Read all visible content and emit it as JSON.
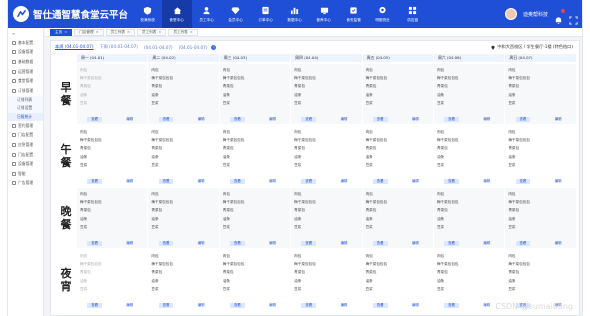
{
  "app": {
    "title": "智仕通智慧食堂云平台"
  },
  "nav": [
    {
      "label": "校满系统",
      "icon": "shield-icon"
    },
    {
      "label": "食堂中心",
      "icon": "home-icon",
      "active": true
    },
    {
      "label": "员工中心",
      "icon": "user-icon"
    },
    {
      "label": "会员中心",
      "icon": "diamond-icon"
    },
    {
      "label": "订单中心",
      "icon": "order-icon"
    },
    {
      "label": "数据中心",
      "icon": "chart-icon"
    },
    {
      "label": "营养中心",
      "icon": "tv-icon"
    },
    {
      "label": "食安监管",
      "icon": "box-icon"
    },
    {
      "label": "明厨亮灶",
      "icon": "camera-icon"
    },
    {
      "label": "供应链",
      "icon": "grid-icon"
    }
  ],
  "user": {
    "name": "迪奥帮科技"
  },
  "sidebar": {
    "header": "≡",
    "items": [
      {
        "label": "基本配置"
      },
      {
        "label": "设备管理"
      },
      {
        "label": "基础数据"
      },
      {
        "label": "运营管理"
      },
      {
        "label": "食堂管理"
      },
      {
        "label": "订餐管理"
      }
    ],
    "subitems": [
      {
        "label": "订餐列表"
      },
      {
        "label": "订餐设置"
      },
      {
        "label": "日报统计",
        "active": true
      }
    ],
    "items2": [
      {
        "label": "签约管理"
      },
      {
        "label": "门店配置"
      },
      {
        "label": "应急管理"
      },
      {
        "label": "门店配置"
      },
      {
        "label": "设备管理"
      },
      {
        "label": "智能"
      },
      {
        "label": "广告管理"
      }
    ]
  },
  "tabs": [
    {
      "label": "主页",
      "active": true
    },
    {
      "label": "门店管理"
    },
    {
      "label": "员工列表"
    },
    {
      "label": "员工列表"
    },
    {
      "label": "员工列表"
    }
  ],
  "weeks": [
    {
      "label": "本周 (04.01-04.07)",
      "style": "cur"
    },
    {
      "label": "下周 (04.01-04.07)",
      "style": "gray"
    },
    {
      "label": "(04.01-04.07)",
      "style": "gray"
    },
    {
      "label": "(04.01-04.07)",
      "style": "gray"
    }
  ],
  "location": "中和大西校区 / 学生餐厅-1楼 (特色档口)",
  "days": [
    "周一 (04.01)",
    "周二 (04.02)",
    "周三 (04.03)",
    "周四 (04.04)",
    "周五 (04.05)",
    "周六 (04.06)",
    "周日 (04.07)"
  ],
  "actions": {
    "view": "查看",
    "edit": "编辑"
  },
  "meals": [
    {
      "name": [
        "早",
        "餐"
      ],
      "faded_first": true
    },
    {
      "name": [
        "午",
        "餐"
      ],
      "faded_first": false
    },
    {
      "name": [
        "晚",
        "餐"
      ],
      "faded_first": false
    },
    {
      "name": [
        "夜",
        "宵"
      ],
      "faded_first": true
    }
  ],
  "dishes": [
    "肉包",
    "梅干菜包包包",
    "青菜包",
    "油条",
    "豆浆"
  ],
  "watermark": "CSDN @sumaibang"
}
